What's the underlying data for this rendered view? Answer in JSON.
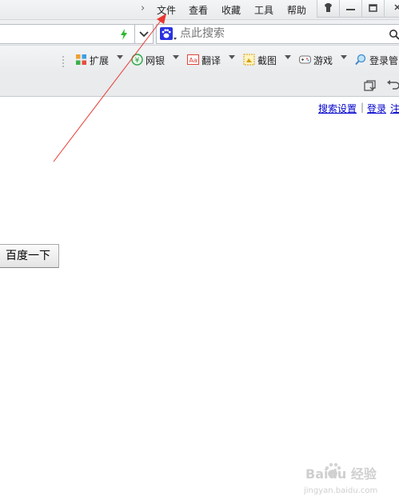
{
  "menubar": {
    "items": [
      "文件",
      "查看",
      "收藏",
      "工具",
      "帮助"
    ]
  },
  "search": {
    "placeholder": "点此搜索"
  },
  "toolbar": {
    "items": [
      {
        "label": "扩展",
        "icon": "extensions-icon"
      },
      {
        "label": "网银",
        "icon": "bank-shield-icon"
      },
      {
        "label": "翻译",
        "icon": "translate-icon"
      },
      {
        "label": "截图",
        "icon": "screenshot-icon"
      },
      {
        "label": "游戏",
        "icon": "gamepad-icon"
      },
      {
        "label": "登录管",
        "icon": "login-manager-icon"
      }
    ]
  },
  "page": {
    "links": {
      "search_settings": "搜索设置",
      "separator": "|",
      "login": "登录",
      "register": "注"
    },
    "search_button": "百度一下"
  },
  "watermark": {
    "text": "Baidu 经验",
    "url": "jingyan.baidu.com"
  },
  "colors": {
    "annotation_arrow": "#e8362e",
    "link": "#0000cc",
    "accent_baidu_blue": "#2932e1"
  }
}
